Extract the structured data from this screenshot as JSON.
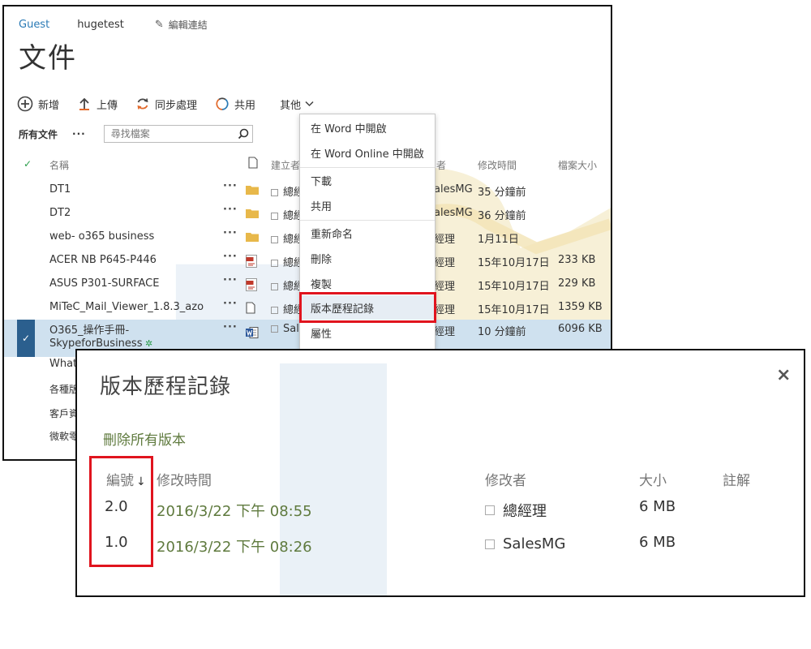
{
  "breadcrumb": {
    "guest": "Guest",
    "site": "hugetest",
    "edit_links": "編輯連結"
  },
  "page_title": "文件",
  "toolbar": {
    "new": "新增",
    "upload": "上傳",
    "sync": "同步處理",
    "share": "共用",
    "more": "其他"
  },
  "view": {
    "all_docs": "所有文件",
    "dots": "···",
    "search_placeholder": "尋找檔案"
  },
  "columns": {
    "name": "名稱",
    "creator": "建立者",
    "modifier_suffix": "者",
    "modified": "修改時間",
    "size": "檔案大小"
  },
  "files": [
    {
      "name": "DT1",
      "type": "folder",
      "creator": "總經",
      "modifier": "alesMG",
      "modified": "35 分鐘前",
      "size": ""
    },
    {
      "name": "DT2",
      "type": "folder",
      "creator": "總經",
      "modifier": "alesMG",
      "modified": "36 分鐘前",
      "size": ""
    },
    {
      "name": "web- o365 business",
      "type": "folder",
      "creator": "總經",
      "modifier": "經理",
      "modified": "1月11日",
      "size": ""
    },
    {
      "name": "ACER NB P645-P446",
      "type": "pdf",
      "creator": "總經",
      "modifier": "經理",
      "modified": "15年10月17日",
      "size": "233 KB"
    },
    {
      "name": "ASUS P301-SURFACE",
      "type": "pdf",
      "creator": "總經",
      "modifier": "經理",
      "modified": "15年10月17日",
      "size": "229 KB"
    },
    {
      "name": "MiTeC_Mail_Viewer_1.8.3_azo",
      "type": "file",
      "creator": "總經",
      "modifier": "經理",
      "modified": "15年10月17日",
      "size": "1359 KB"
    },
    {
      "name": "O365_操作手冊-",
      "name2": "SkypeforBusiness",
      "type": "word",
      "creator": "Sale",
      "modifier": "經理",
      "modified": "10 分鐘前",
      "size": "6096 KB",
      "selected": true
    }
  ],
  "partial_rows": [
    "What",
    "各種版",
    "客戶資",
    "微軟零"
  ],
  "context_menu": {
    "items": [
      "在 Word 中開啟",
      "在 Word Online 中開啟",
      "下載",
      "共用",
      "重新命名",
      "刪除",
      "複製",
      "版本歷程記錄",
      "屬性"
    ],
    "highlighted": "版本歷程記錄"
  },
  "dialog": {
    "title": "版本歷程記錄",
    "close": "×",
    "delete_all": "刪除所有版本",
    "headers": {
      "number": "編號",
      "sort_arrow": "↓",
      "modified": "修改時間",
      "modifier": "修改者",
      "size": "大小",
      "comments": "註解"
    },
    "versions": [
      {
        "number": "2.0",
        "modified": "2016/3/22 下午 08:55",
        "modifier": "總經理",
        "size": "6 MB"
      },
      {
        "number": "1.0",
        "modified": "2016/3/22 下午 08:26",
        "modifier": "SalesMG",
        "size": "6 MB"
      }
    ]
  },
  "colors": {
    "link_blue": "#2a7ab5",
    "selected_row": "#cfe1ef",
    "selected_check": "#2b5f8e",
    "highlight_red": "#e0141e",
    "date_green": "#5f7a3e",
    "folder_yellow": "#e8b84a",
    "sync_orange": "#e26a2c",
    "word_blue": "#2b579a",
    "pdf_red": "#c0392b"
  }
}
